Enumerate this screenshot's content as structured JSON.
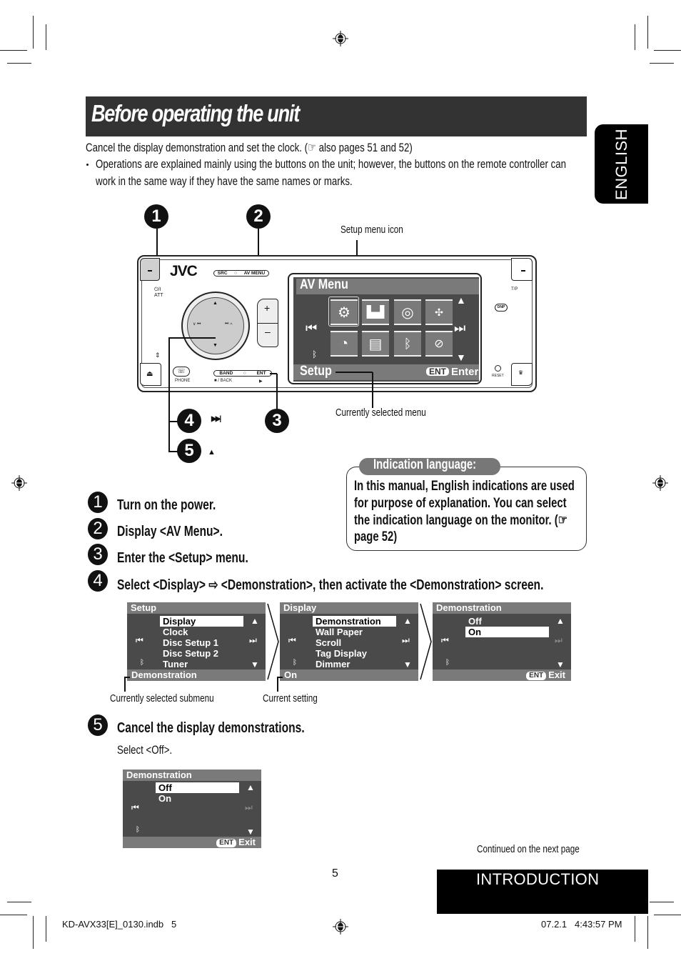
{
  "page": {
    "title": "Before operating the unit",
    "intro": "Cancel the display demonstration and set the clock. (☞ also pages 51 and 52)",
    "bullet_line_1": "Operations are explained mainly using the buttons on the unit; however, the buttons on the remote controller can",
    "bullet_line_2": "work in the same way if they have the same names or marks.",
    "language_tab": "ENGLISH",
    "page_number": "5",
    "section_tab": "INTRODUCTION",
    "continued": "Continued on the next page",
    "footer_left": "KD-AVX33[E]_0130.indb   5",
    "footer_right": "07.2.1   4:43:57 PM"
  },
  "diagram": {
    "callout_numbers": [
      "1",
      "2",
      "3",
      "4",
      "5"
    ],
    "callout_4_symbol": "▶▶|",
    "callout_5_symbol": "▲",
    "setup_menu_icon_label": "Setup menu icon",
    "currently_selected_menu_label": "Currently selected menu",
    "unit": {
      "brand": "JVC",
      "src_label": "SRC",
      "av_menu_label": "AV MENU",
      "power_label": "⏻/I",
      "att_label": "ATT",
      "band_label": "BAND",
      "ent_label": "ENT",
      "phone_label": "PHONE",
      "back_label": "■ / BACK",
      "play_label": "▶",
      "tp_label": "T/P",
      "dnp_label": "DNP",
      "reset_label": "RESET",
      "plus": "+",
      "minus": "–",
      "dial_left": "∨ ⏮",
      "dial_right": "⏭ ∧",
      "screen_title": "AV Menu",
      "screen_footer_left": "Setup",
      "screen_footer_ent": "ENT",
      "screen_footer_right": "Enter",
      "icons": [
        "setup-gears",
        "equalizer",
        "speaker",
        "surround",
        "dial-clock",
        "document",
        "bluetooth",
        "tuner-disc"
      ]
    }
  },
  "indication_box": {
    "heading": "Indication language:",
    "line_1": "In this manual, English indications are used",
    "line_2": "for purpose of explanation. You can select",
    "line_3": "the indication language on the monitor. (☞",
    "line_4": "page 52)"
  },
  "steps": [
    {
      "number": "1",
      "text": "Turn on the power."
    },
    {
      "number": "2",
      "text": "Display <AV Menu>."
    },
    {
      "number": "3",
      "text": "Enter the <Setup> menu."
    },
    {
      "number": "4",
      "text": "Select <Display> ⇨ <Demonstration>, then activate the <Demonstration> screen."
    },
    {
      "number": "5",
      "text": "Cancel the display demonstrations.",
      "sub": "Select <Off>."
    }
  ],
  "screens": {
    "setup": {
      "title": "Setup",
      "items": [
        "Display",
        "Clock",
        "Disc Setup 1",
        "Disc Setup 2",
        "Tuner"
      ],
      "selected": "Display",
      "footer": "Demonstration"
    },
    "display": {
      "title": "Display",
      "items": [
        "Demonstration",
        "Wall Paper",
        "Scroll",
        "Tag Display",
        "Dimmer"
      ],
      "selected": "Demonstration",
      "footer": "On"
    },
    "demonstration": {
      "title": "Demonstration",
      "items": [
        "Off",
        "On"
      ],
      "selected": "On",
      "footer_ent": "ENT",
      "footer_exit": "Exit"
    },
    "demonstration_off": {
      "title": "Demonstration",
      "items": [
        "Off",
        "On"
      ],
      "selected": "Off",
      "footer_ent": "ENT",
      "footer_exit": "Exit"
    },
    "currently_selected_submenu_label": "Currently selected submenu",
    "current_setting_label": "Current setting"
  }
}
